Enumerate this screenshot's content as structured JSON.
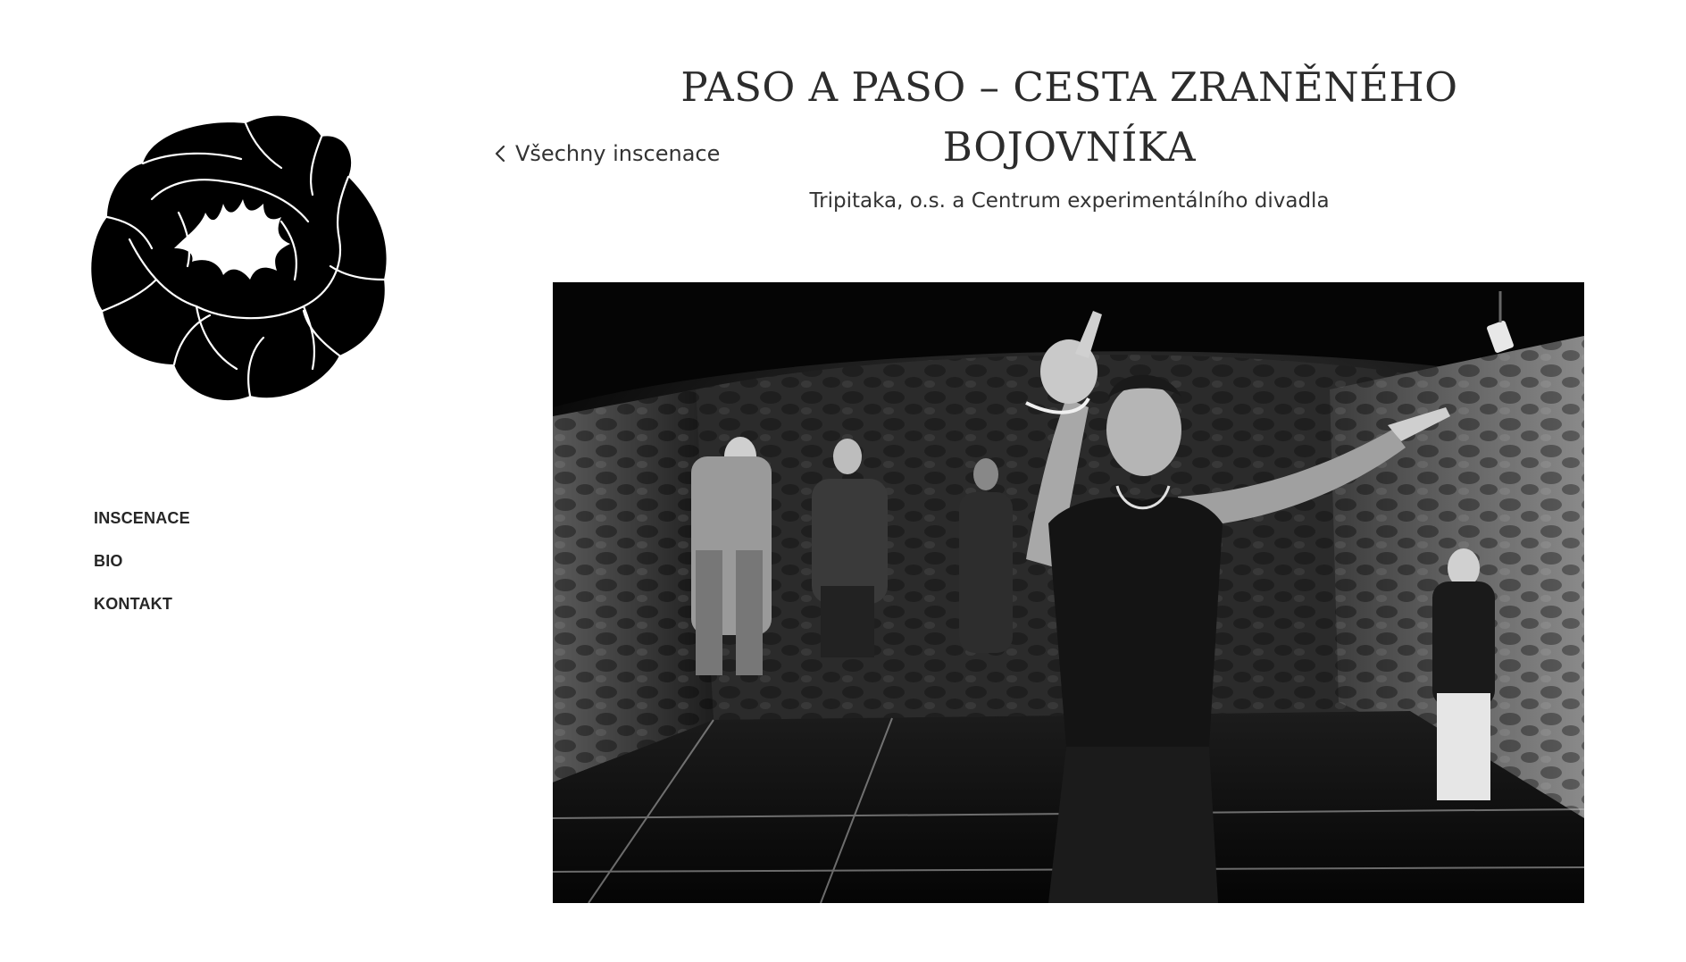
{
  "logo": {
    "icon": "peony-flower-logo-icon",
    "color": "#000000"
  },
  "nav": {
    "items": [
      {
        "label": "INSCENACE"
      },
      {
        "label": "BIO"
      },
      {
        "label": "KONTAKT"
      }
    ]
  },
  "back_link": {
    "label": "Všechny inscenace",
    "icon": "chevron-left-icon"
  },
  "production": {
    "title": "PASO A PASO – CESTA ZRANĚNÉHO BOJOVNÍKA",
    "subtitle": "Tripitaka, o.s. a Centrum experimentálního divadla"
  },
  "photo": {
    "style": "black-and-white"
  }
}
